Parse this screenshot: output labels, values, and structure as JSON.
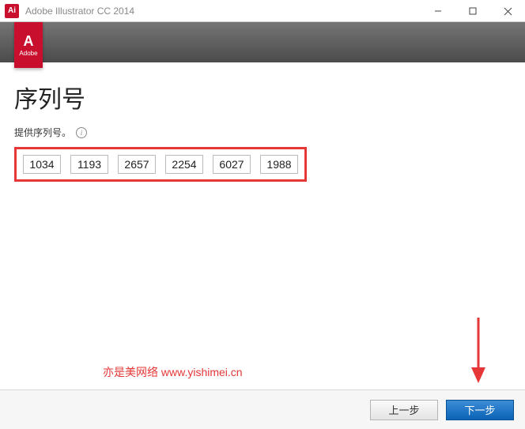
{
  "window": {
    "title": "Adobe Illustrator CC 2014",
    "app_icon_text": "Ai"
  },
  "logo": {
    "main": "A",
    "sub": "Adobe"
  },
  "page": {
    "title": "序列号",
    "subtitle": "提供序列号。"
  },
  "serial": {
    "fields": [
      "1034",
      "1193",
      "2657",
      "2254",
      "6027",
      "1988"
    ]
  },
  "watermark": {
    "text": "亦是美网络  www.yishimei.cn"
  },
  "footer": {
    "back": "上一步",
    "next": "下一步"
  }
}
